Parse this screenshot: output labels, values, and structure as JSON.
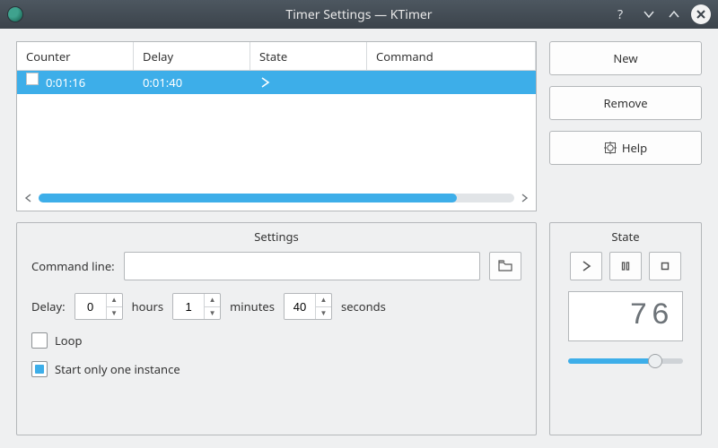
{
  "window": {
    "title": "Timer Settings — KTimer"
  },
  "table": {
    "headers": {
      "counter": "Counter",
      "delay": "Delay",
      "state": "State",
      "command": "Command"
    },
    "rows": [
      {
        "counter": "0:01:16",
        "delay": "0:01:40",
        "state_icon": "play-icon",
        "command": ""
      }
    ]
  },
  "buttons": {
    "new": "New",
    "remove": "Remove",
    "help": "Help"
  },
  "settings": {
    "legend": "Settings",
    "command_line_label": "Command line:",
    "command_line_value": "",
    "delay_label": "Delay:",
    "hours_label": "hours",
    "minutes_label": "minutes",
    "seconds_label": "seconds",
    "hours": "0",
    "minutes": "1",
    "seconds": "40",
    "loop_label": "Loop",
    "loop_checked": false,
    "single_instance_label": "Start only one instance",
    "single_instance_checked": true
  },
  "state": {
    "legend": "State",
    "display": "76",
    "slider_percent": 76
  },
  "colors": {
    "accent": "#3daee9"
  }
}
